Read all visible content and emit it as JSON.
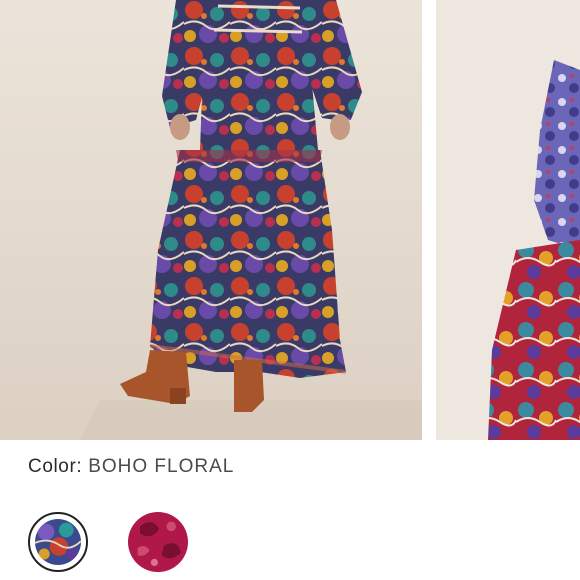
{
  "gallery": {
    "images": [
      {
        "name": "model-back-view"
      },
      {
        "name": "fabric-detail-view"
      }
    ]
  },
  "color": {
    "label": "Color:",
    "selected": "BOHO FLORAL"
  },
  "swatches": [
    {
      "name": "boho-floral",
      "selected": true,
      "color": "#3b4a8c"
    },
    {
      "name": "red-paisley",
      "selected": false,
      "color": "#b0184a"
    }
  ]
}
